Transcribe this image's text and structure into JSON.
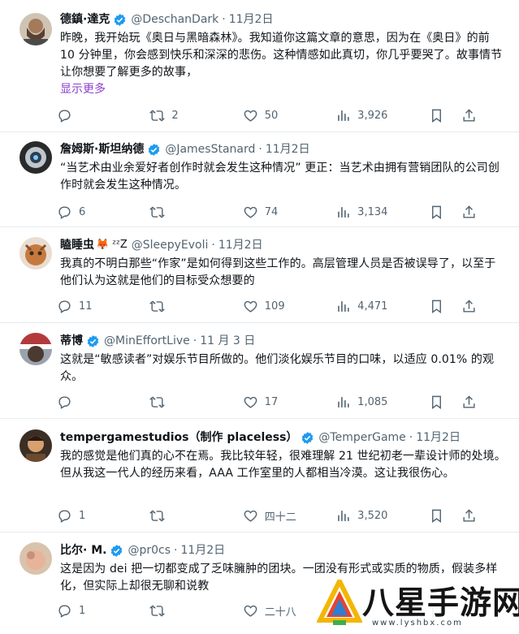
{
  "tweets": [
    {
      "name": "德鎮·達克",
      "handle": "@DeschanDark",
      "date": "11月2日",
      "verified": true,
      "text": "昨晚，我开始玩《奥日与黑暗森林》。我知道你这篇文章的意思，因为在《奥日》的前 10 分钟里，你会感到快乐和深深的悲伤。这种情感如此真切，你几乎要哭了。故事情节让你想要了解更多的故事，",
      "show_more": "显示更多",
      "replies": "",
      "retweets": "2",
      "likes": "50",
      "views": "3,926"
    },
    {
      "name": "詹姆斯·斯坦纳德",
      "handle": "@JamesStanard",
      "date": "11月2日",
      "verified": true,
      "text": "“当艺术由业余爱好者创作时就会发生这种情况” 更正：当艺术由拥有营销团队的公司创作时就会发生这种情况。",
      "replies": "6",
      "retweets": "",
      "likes": "74",
      "views": "3,134"
    },
    {
      "name": "瞌睡虫",
      "handle": "@SleepyEvoli",
      "date": "11月2日",
      "verified": false,
      "emoji": "🦊 ᶻᶻZ",
      "text": "我真的不明白那些“作家”是如何得到这些工作的。高层管理人员是否被误导了，以至于他们认为这就是他们的目标受众想要的",
      "replies": "11",
      "retweets": "",
      "likes": "109",
      "views": "4,471"
    },
    {
      "name": "蒂博",
      "handle": "@MinEffortLive",
      "date": "11 月 3 日",
      "verified": true,
      "text": "这就是“敏感读者”对娱乐节目所做的。他们淡化娱乐节目的口味，以适应 0.01% 的观众。",
      "replies": "",
      "retweets": "",
      "likes": "17",
      "views": "1,085"
    },
    {
      "name": "tempergamestudios（制作 placeless）",
      "handle": "@TemperGame",
      "date": "11月2日",
      "verified": true,
      "text": "我的感觉是他们真的心不在焉。我比较年轻，很难理解 21 世纪初老一辈设计师的处境。但从我这一代人的经历来看，AAA 工作室里的人都相当冷漠。这让我很伤心。",
      "replies": "1",
      "retweets": "",
      "likes": "四十二",
      "views": "3,520"
    },
    {
      "name": "比尔· M.",
      "handle": "@pr0cs",
      "date": "11月2日",
      "verified": true,
      "text": "这是因为 dei 把一切都变成了乏味臃肿的团块。一团没有形式或实质的物质，假装多样化，但实际上却很无聊和说教",
      "replies": "1",
      "retweets": "",
      "likes": "二十八",
      "views": ""
    }
  ],
  "watermark": {
    "title": "八星手游网",
    "url": "www.lyshbx.com"
  },
  "colors": {
    "verified": "#1d9bf0",
    "show_more": "#8b3fd1",
    "muted": "#536471",
    "divider": "#e6ecf0"
  }
}
